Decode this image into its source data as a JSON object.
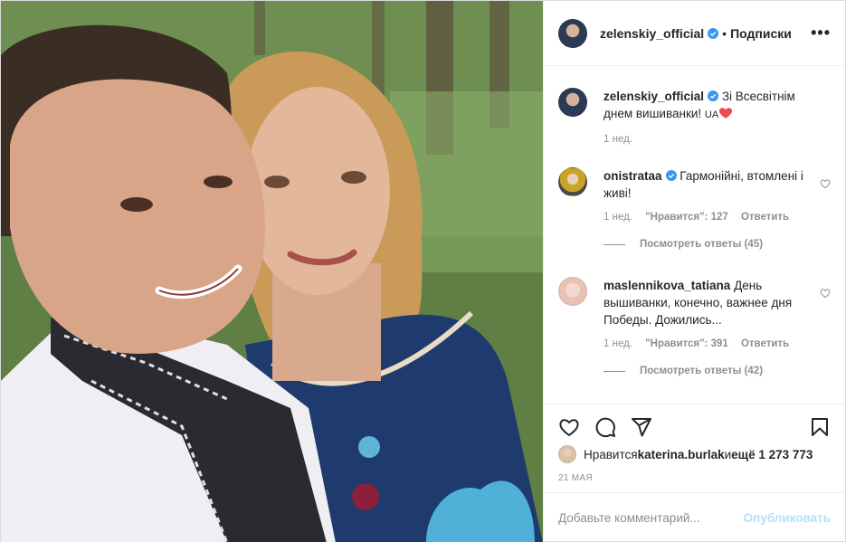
{
  "header": {
    "username": "zelenskiy_official",
    "dot": "•",
    "follow_label": "Подписки",
    "more": "•••"
  },
  "caption": {
    "username": "zelenskiy_official",
    "text": "Зі Всесвітнім днем вишиванки! ",
    "flag_text": "UA",
    "time": "1 нед."
  },
  "comments": [
    {
      "username": "onistrataa",
      "text": "Гармонійні, втомлені і живі!",
      "time": "1 нед.",
      "likes": "\"Нравится\": 127",
      "reply_label": "Ответить",
      "view_replies": "Посмотреть ответы (45)"
    },
    {
      "username": "maslennikova_tatiana",
      "text": "День вышиванки, конечно, важнее дня Победы. Дожились...",
      "time": "1 нед.",
      "likes": "\"Нравится\": 391",
      "reply_label": "Ответить",
      "view_replies": "Посмотреть ответы (42)"
    }
  ],
  "likes_line": {
    "prefix": "Нравится ",
    "user": "katerina.burlak",
    "middle": " и ",
    "count": "ещё 1 273 773"
  },
  "date": "21 МАЯ",
  "add_comment": {
    "placeholder": "Добавьте комментарий...",
    "publish_label": "Опубликовать"
  },
  "icons": {
    "like": "heart-icon",
    "comment": "comment-icon",
    "share": "share-icon",
    "save": "bookmark-icon",
    "verified": "verified-badge-icon"
  },
  "colors": {
    "verified": "#3897f0",
    "publish": "#b2dffc",
    "secondary_text": "#8e8e8e",
    "heart_emoji": "#ed4956"
  }
}
